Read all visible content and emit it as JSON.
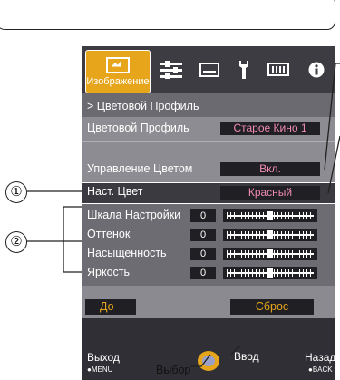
{
  "tabs": {
    "image_label": "Изображение"
  },
  "breadcrumb": "> Цветовой Профиль",
  "rows": {
    "color_profile": {
      "label": "Цветовой Профиль",
      "value": "Старое Кино 1"
    },
    "color_management": {
      "label": "Управление Цветом",
      "value": "Вкл."
    },
    "current_color": {
      "label": "Наст. Цвет",
      "value": "Красный"
    }
  },
  "sliders": [
    {
      "label": "Шкала Настройки",
      "value": "0",
      "level": 0
    },
    {
      "label": "Оттенок",
      "value": "0",
      "level": 0
    },
    {
      "label": "Насыщенность",
      "value": "0",
      "level": 0
    },
    {
      "label": "Яркость",
      "value": "0",
      "level": 0
    }
  ],
  "buttons": {
    "before": "До",
    "reset": "Сброс"
  },
  "footer": {
    "exit": "Выход",
    "exit_key": "●MENU",
    "select": "Выбор",
    "enter": "Ввод",
    "back": "Назад",
    "back_key": "●BACK"
  },
  "callouts": [
    "①",
    "②"
  ],
  "colors": {
    "accent": "#e6a51a",
    "value_text": "#f08cb0",
    "panel": "#8c8c92",
    "dark": "#1f1f24"
  }
}
